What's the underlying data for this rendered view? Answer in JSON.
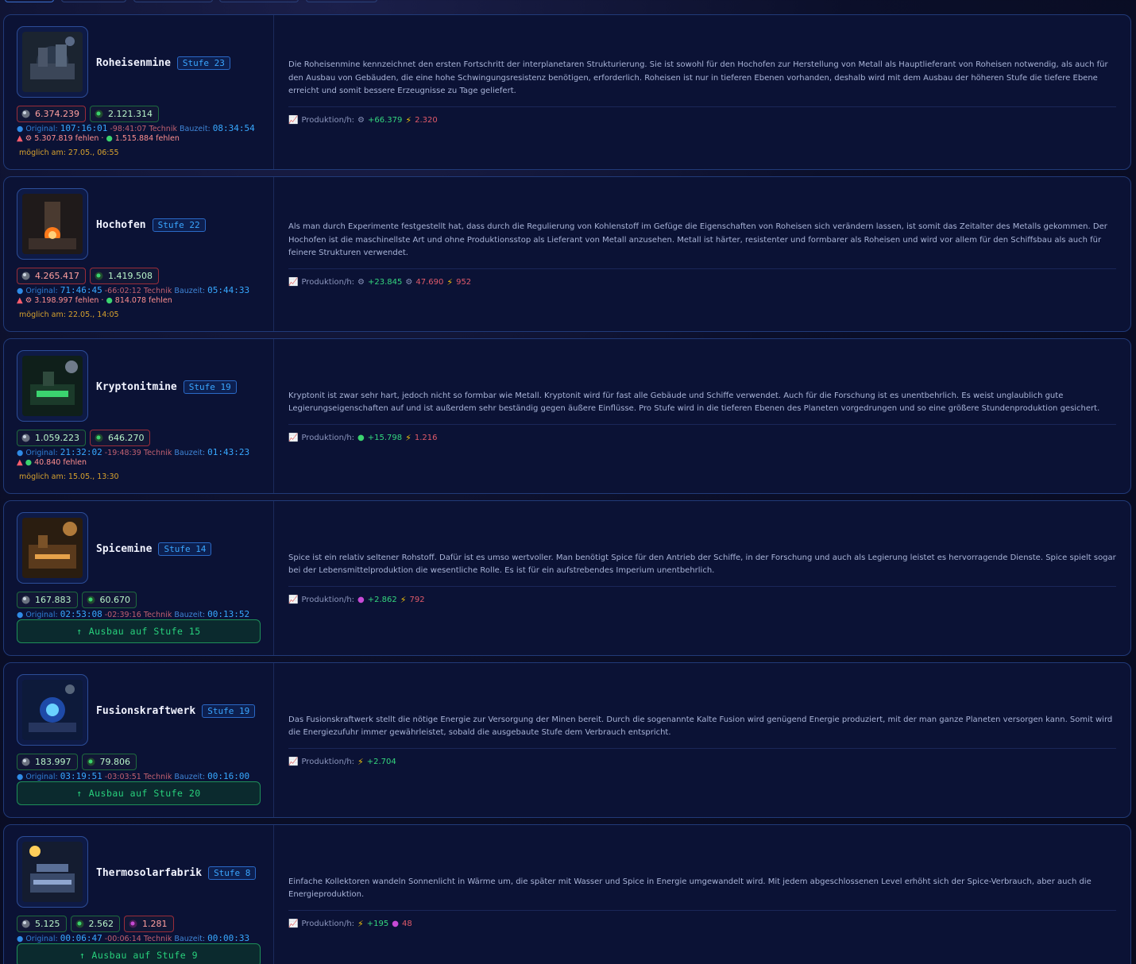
{
  "cards": [
    {
      "name": "Roheisenmine",
      "stufe": "Stufe 23",
      "cost1": "6.374.239",
      "cost2": "2.121.314",
      "original_label": "Original:",
      "original_time": "107:16:01",
      "reduction": "-98:41:07",
      "technik": "Technik",
      "bauzeit_label": "Bauzeit:",
      "bauzeit": "08:34:54",
      "missing1": "5.307.819 fehlen",
      "missing2": "1.515.884 fehlen",
      "possible": "möglich am: 27.05., 06:55",
      "description": "Die Roheisenmine kennzeichnet den ersten Fortschritt der interplanetaren Strukturierung. Sie ist sowohl für den Hochofen zur Herstellung von Metall als Hauptlieferant von Roheisen notwendig, als auch für den Ausbau von Gebäuden, die eine hohe Schwingungsresistenz benötigen, erforderlich. Roheisen ist nur in tieferen Ebenen vorhanden, deshalb wird mit dem Ausbau der höheren Stufe die tiefere Ebene erreicht und somit bessere Erzeugnisse zu Tage geliefert.",
      "prod_label": "Produktion/h:",
      "prod1": "+66.379",
      "prod2": "2.320"
    },
    {
      "name": "Hochofen",
      "stufe": "Stufe 22",
      "cost1": "4.265.417",
      "cost2": "1.419.508",
      "original_label": "Original:",
      "original_time": "71:46:45",
      "reduction": "-66:02:12",
      "technik": "Technik",
      "bauzeit_label": "Bauzeit:",
      "bauzeit": "05:44:33",
      "missing1": "3.198.997 fehlen",
      "missing2": "814.078 fehlen",
      "possible": "möglich am: 22.05., 14:05",
      "description": "Als man durch Experimente festgestellt hat, dass durch die Regulierung von Kohlenstoff im Gefüge die Eigenschaften von Roheisen sich verändern lassen, ist somit das Zeitalter des Metalls gekommen. Der Hochofen ist die maschinellste Art und ohne Produktionsstop als Lieferant von Metall anzusehen. Metall ist härter, resistenter und formbarer als Roheisen und wird vor allem für den Schiffsbau als auch für feinere Strukturen verwendet.",
      "prod_label": "Produktion/h:",
      "prod1": "+23.845",
      "prod2": "47.690",
      "prod3": "952"
    },
    {
      "name": "Kryptonitmine",
      "stufe": "Stufe 19",
      "cost1": "1.059.223",
      "cost2": "646.270",
      "original_label": "Original:",
      "original_time": "21:32:02",
      "reduction": "-19:48:39",
      "technik": "Technik",
      "bauzeit_label": "Bauzeit:",
      "bauzeit": "01:43:23",
      "missing2": "40.840 fehlen",
      "possible": "möglich am: 15.05., 13:30",
      "description": "Kryptonit ist zwar sehr hart, jedoch nicht so formbar wie Metall. Kryptonit wird für fast alle Gebäude und Schiffe verwendet. Auch für die Forschung ist es unentbehrlich. Es weist unglaublich gute Legierungseigenschaften auf und ist außerdem sehr beständig gegen äußere Einflüsse. Pro Stufe wird in die tieferen Ebenen des Planeten vorgedrungen und so eine größere Stundenproduktion gesichert.",
      "prod_label": "Produktion/h:",
      "prod1": "+15.798",
      "prod2": "1.216"
    },
    {
      "name": "Spicemine",
      "stufe": "Stufe 14",
      "cost1": "167.883",
      "cost2": "60.670",
      "original_label": "Original:",
      "original_time": "02:53:08",
      "reduction": "-02:39:16",
      "technik": "Technik",
      "bauzeit_label": "Bauzeit:",
      "bauzeit": "00:13:52",
      "button": "Ausbau auf Stufe 15",
      "description": "Spice ist ein relativ seltener Rohstoff. Dafür ist es umso wertvoller. Man benötigt Spice für den Antrieb der Schiffe, in der Forschung und auch als Legierung leistet es hervorragende Dienste. Spice spielt sogar bei der Lebensmittelproduktion die wesentliche Rolle. Es ist für ein aufstrebendes Imperium unentbehrlich.",
      "prod_label": "Produktion/h:",
      "prod1": "+2.862",
      "prod2": "792"
    },
    {
      "name": "Fusionskraftwerk",
      "stufe": "Stufe 19",
      "cost1": "183.997",
      "cost2": "79.806",
      "original_label": "Original:",
      "original_time": "03:19:51",
      "reduction": "-03:03:51",
      "technik": "Technik",
      "bauzeit_label": "Bauzeit:",
      "bauzeit": "00:16:00",
      "button": "Ausbau auf Stufe 20",
      "description": "Das Fusionskraftwerk stellt die nötige Energie zur Versorgung der Minen bereit. Durch die sogenannte Kalte Fusion wird genügend Energie produziert, mit der man ganze Planeten versorgen kann. Somit wird die Energiezufuhr immer gewährleistet, sobald die ausgebaute Stufe dem Verbrauch entspricht.",
      "prod_label": "Produktion/h:",
      "prod1": "+2.704"
    },
    {
      "name": "Thermosolarfabrik",
      "stufe": "Stufe 8",
      "cost1": "5.125",
      "cost2": "2.562",
      "cost3": "1.281",
      "original_label": "Original:",
      "original_time": "00:06:47",
      "reduction": "-00:06:14",
      "technik": "Technik",
      "bauzeit_label": "Bauzeit:",
      "bauzeit": "00:00:33",
      "button": "Ausbau auf Stufe 9",
      "description": "Einfache Kollektoren wandeln Sonnenlicht in Wärme um, die später mit Wasser und Spice in Energie umgewandelt wird. Mit jedem abgeschlossenen Level erhöht sich der Spice-Verbrauch, aber auch die Energieproduktion.",
      "prod_label": "Produktion/h:",
      "prod1": "+195",
      "prod2": "48"
    }
  ]
}
